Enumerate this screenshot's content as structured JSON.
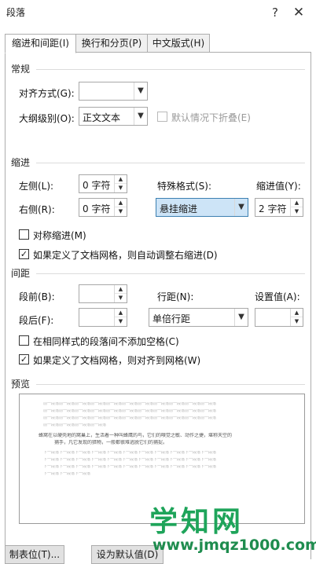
{
  "window": {
    "title": "段落",
    "help": "?",
    "close": "✕"
  },
  "tabs": [
    {
      "label": "缩进和间距(I)",
      "active": true
    },
    {
      "label": "换行和分页(P)",
      "active": false
    },
    {
      "label": "中文版式(H)",
      "active": false
    }
  ],
  "general": {
    "section": "常规",
    "alignment_label": "对齐方式(G):",
    "alignment_value": "",
    "outline_label": "大纲级别(O):",
    "outline_value": "正文文本",
    "collapse_label": "默认情况下折叠(E)"
  },
  "indent": {
    "section": "缩进",
    "left_label": "左侧(L):",
    "left_value": "0 字符",
    "right_label": "右侧(R):",
    "right_value": "0 字符",
    "special_label": "特殊格式(S):",
    "special_value": "悬挂缩进",
    "by_label": "缩进值(Y):",
    "by_value": "2 字符",
    "mirror_label": "对称缩进(M)",
    "auto_adjust_label": "如果定义了文档网格，则自动调整右缩进(D)"
  },
  "spacing": {
    "section": "间距",
    "before_label": "段前(B):",
    "before_value": "",
    "after_label": "段后(F):",
    "after_value": "",
    "line_label": "行距(N):",
    "line_value": "单倍行距",
    "at_label": "设置值(A):",
    "at_value": "",
    "no_space_label": "在相同样式的段落间不添加空格(C)",
    "snap_grid_label": "如果定义了文档网格，则对齐到网格(W)"
  },
  "preview": {
    "section": "预览",
    "prev_lines": [
      "前一段落前一段落前一段落前一段落前一段落前一段落前一段落前一段落前一段落前一段落前一段落",
      "前一段落前一段落前一段落前一段落前一段落前一段落前一段落前一段落前一段落前一段落前一段落",
      "前一段落前一段落前一段落前一段落前一段落前一段落前一段落前一段落前一段落前一段落前一段落",
      "前一段落前一段落前一段落前一段落"
    ],
    "sample_lines": [
      "蜂窝在以硬壳地的窝巢上，生活着一种叫蜂鹰的鸟，它们的嗅觉之敏、动作之捷，堪称天空的",
      "捕手，凡它发现的猎物，一般都很难逃脱它们的捕捉。"
    ],
    "next_lines": [
      "下一段落下一段落下一段落下一段落下一段落下一段落下一段落下一段落下一段落下一段落下一段落",
      "下一段落下一段落下一段落下一段落下一段落下一段落下一段落下一段落下一段落下一段落下一段落",
      "下一段落下一段落下一段落下一段落下一段落下一段落下一段落下一段落下一段落下一段落下一段落",
      "下一段落下一段落下一段落"
    ]
  },
  "buttons": {
    "tabs_label": "制表位(T)...",
    "default_label": "设为默认值(D)"
  },
  "watermark": {
    "main": "学知网",
    "url": "www.jmqz1000.com"
  },
  "colors": {
    "accent": "#3c7fb1",
    "selection": "#cde4f7",
    "watermark": "#1ea45a"
  }
}
